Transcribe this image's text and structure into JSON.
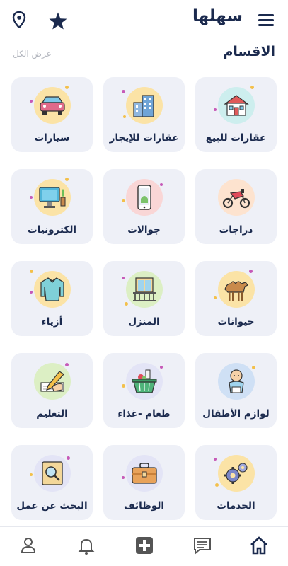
{
  "header": {
    "brand": "سهلها",
    "location_icon": "location-pin-icon",
    "favorites_icon": "star-icon",
    "menu_icon": "hamburger-menu-icon"
  },
  "section": {
    "title": "الاقسام",
    "see_all": "عرض الكل"
  },
  "categories": [
    {
      "label": "عقارات للبيع",
      "icon": "house-icon"
    },
    {
      "label": "عقارات للإيجار",
      "icon": "building-icon"
    },
    {
      "label": "سيارات",
      "icon": "car-icon"
    },
    {
      "label": "دراجات",
      "icon": "motorcycle-icon"
    },
    {
      "label": "جوالات",
      "icon": "mobile-phone-icon"
    },
    {
      "label": "الكترونيات",
      "icon": "computer-monitor-icon"
    },
    {
      "label": "حيوانات",
      "icon": "camel-icon"
    },
    {
      "label": "المنزل",
      "icon": "balcony-window-icon"
    },
    {
      "label": "أزياء",
      "icon": "sweater-icon"
    },
    {
      "label": "لوازم الأطفال",
      "icon": "baby-icon"
    },
    {
      "label": "طعام -غذاء",
      "icon": "grocery-basket-icon"
    },
    {
      "label": "التعليم",
      "icon": "writing-hand-icon"
    },
    {
      "label": "الخدمات",
      "icon": "gears-icon"
    },
    {
      "label": "الوظائف",
      "icon": "briefcase-icon"
    },
    {
      "label": "البحث عن عمل",
      "icon": "job-search-icon"
    }
  ],
  "bottom_nav": [
    {
      "name": "home",
      "icon": "home-icon",
      "active": true
    },
    {
      "name": "messages",
      "icon": "chat-icon",
      "active": false
    },
    {
      "name": "add",
      "icon": "add-plus-icon",
      "active": false
    },
    {
      "name": "notifications",
      "icon": "bell-icon",
      "active": false
    },
    {
      "name": "profile",
      "icon": "user-icon",
      "active": false
    }
  ],
  "colors": {
    "primary": "#1b2a4e",
    "card_bg": "#eef0f7",
    "muted_text": "#b5b8c0"
  }
}
